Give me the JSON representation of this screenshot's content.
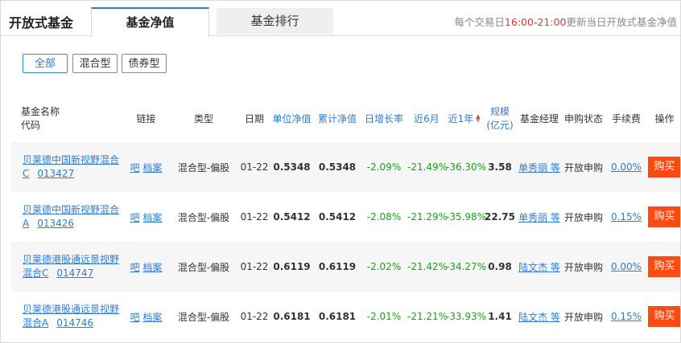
{
  "app_title": "开放式基金",
  "tabs": [
    {
      "label": "基金净值",
      "active": true
    },
    {
      "label": "基金排行",
      "active": false
    }
  ],
  "notice": {
    "prefix": "每个交易日",
    "time": "16:00-21:00",
    "suffix": "更新当日开放式基金净值"
  },
  "filters": [
    "全部",
    "混合型",
    "债券型"
  ],
  "selected_filter": "全部",
  "columns": {
    "name_line1": "基金名称",
    "name_line2": "代码",
    "link": "链接",
    "type": "类型",
    "date": "日期",
    "unit_nav": "单位净值",
    "acc_nav": "累计净值",
    "daily_growth": "日增长率",
    "six_month": "近6月",
    "one_year": "近1年",
    "scale_line1": "规模",
    "scale_line2": "(亿元)",
    "manager": "基金经理",
    "purchase_status": "申购状态",
    "fee": "手续费",
    "action": "操作"
  },
  "rows": [
    {
      "name_a": "贝莱德中国新视野混合",
      "name_b": "C",
      "code": "013427",
      "link1": "吧",
      "link2": "档案",
      "type": "混合型-偏股",
      "date": "01-22",
      "unit_nav": "0.5348",
      "acc_nav": "0.5348",
      "daily_growth": "-2.09%",
      "six_month": "-21.49%",
      "one_year": "-36.30%",
      "scale": "3.58",
      "manager": "单秀丽 等",
      "status": "开放申购",
      "fee": "0.00%",
      "buy": "购买"
    },
    {
      "name_a": "贝莱德中国新视野混合",
      "name_b": "A",
      "code": "013426",
      "link1": "吧",
      "link2": "档案",
      "type": "混合型-偏股",
      "date": "01-22",
      "unit_nav": "0.5412",
      "acc_nav": "0.5412",
      "daily_growth": "-2.08%",
      "six_month": "-21.29%",
      "one_year": "-35.98%",
      "scale": "22.75",
      "manager": "单秀丽 等",
      "status": "开放申购",
      "fee": "0.15%",
      "buy": "购买"
    },
    {
      "name_a": "贝莱德港股通远景视野",
      "name_b": "混合C",
      "code": "014747",
      "link1": "吧",
      "link2": "档案",
      "type": "混合型-偏股",
      "date": "01-22",
      "unit_nav": "0.6119",
      "acc_nav": "0.6119",
      "daily_growth": "-2.02%",
      "six_month": "-21.42%",
      "one_year": "-34.27%",
      "scale": "0.98",
      "manager": "陆文杰 等",
      "status": "开放申购",
      "fee": "0.00%",
      "buy": "购买"
    },
    {
      "name_a": "贝莱德港股通远景视野",
      "name_b": "混合A",
      "code": "014746",
      "link1": "吧",
      "link2": "档案",
      "type": "混合型-偏股",
      "date": "01-22",
      "unit_nav": "0.6181",
      "acc_nav": "0.6181",
      "daily_growth": "-2.01%",
      "six_month": "-21.21%",
      "one_year": "-33.93%",
      "scale": "1.41",
      "manager": "陆文杰 等",
      "status": "开放申购",
      "fee": "0.15%",
      "buy": "购买"
    }
  ]
}
